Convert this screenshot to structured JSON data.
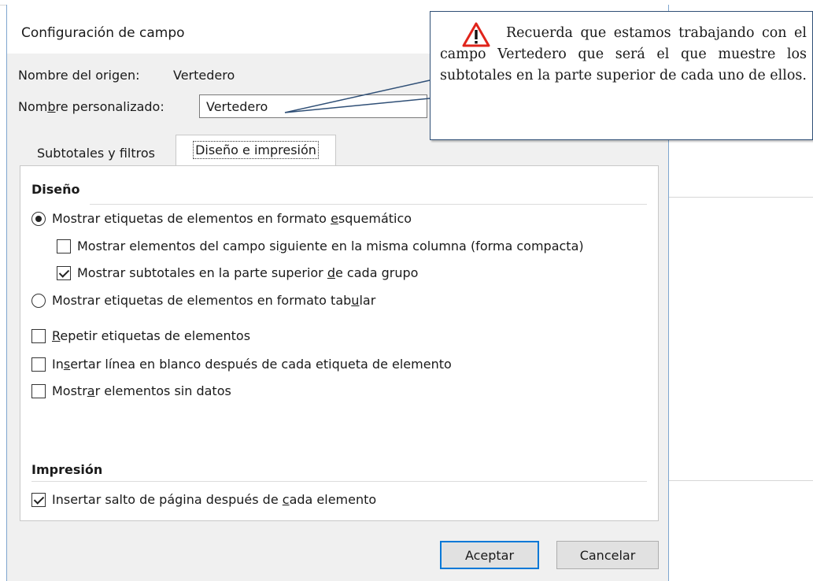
{
  "dialog": {
    "title": "Configuración de campo",
    "source_name_label": "Nombre del origen:",
    "source_name_value": "Vertedero",
    "custom_name_label_pre": "Nom",
    "custom_name_label_u": "b",
    "custom_name_label_post": "re personalizado:",
    "custom_name_value": "Vertedero"
  },
  "tabs": {
    "subtotals": "Subtotales y filtros",
    "layout": "Diseño e impresión"
  },
  "layout_section": {
    "title": "Diseño",
    "outline_pre": "Mostrar etiquetas de elementos en formato ",
    "outline_u": "e",
    "outline_post": "squemático",
    "compact_pre": "Mostrar elementos del campo si",
    "compact_u": "g",
    "compact_post": "uiente en la misma columna (forma compacta)",
    "subtotals_top_pre": "Mostrar subtotales en la parte superior ",
    "subtotals_top_u": "d",
    "subtotals_top_post": "e cada grupo",
    "tabular_pre": "Mostrar etiquetas de elementos en formato tab",
    "tabular_u": "u",
    "tabular_post": "lar",
    "repeat_u": "R",
    "repeat_post": "epetir etiquetas de elementos",
    "blank_pre": "In",
    "blank_u": "s",
    "blank_post": "ertar línea en blanco después de cada etiqueta de elemento",
    "nodata_pre": "Mostr",
    "nodata_u": "a",
    "nodata_post": "r elementos sin datos"
  },
  "print_section": {
    "title": "Impresión",
    "pagebreak_pre": "Insertar salto de página después de ",
    "pagebreak_u": "c",
    "pagebreak_post": "ada elemento"
  },
  "state": {
    "outline_selected": true,
    "tabular_selected": false,
    "compact_checked": false,
    "subtotals_top_checked": true,
    "repeat_checked": false,
    "blank_checked": false,
    "nodata_checked": false,
    "pagebreak_checked": true
  },
  "buttons": {
    "ok": "Aceptar",
    "cancel": "Cancelar"
  },
  "callout": {
    "text": "Recuerda que estamos trabajando con el campo Vertedero que será el que muestre los subtotales en la parte superior de cada uno de ellos.",
    "icon": "warning-triangle-icon",
    "icon_color": "#e0241b",
    "border_color": "#2f4f76"
  }
}
